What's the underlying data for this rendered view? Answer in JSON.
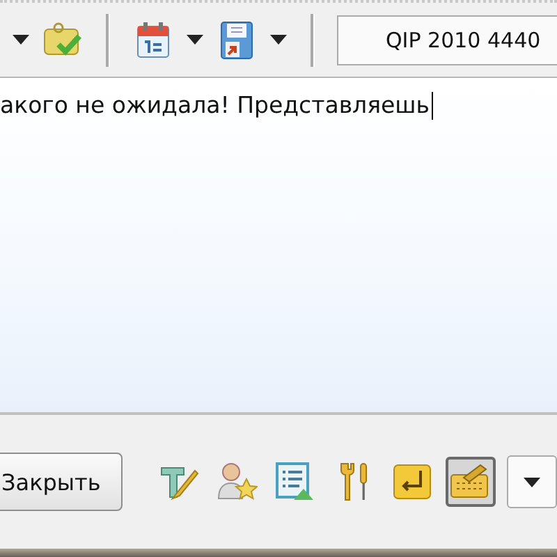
{
  "top_toolbar": {
    "items": [
      {
        "kind": "dropdown"
      },
      {
        "kind": "note"
      },
      {
        "kind": "separator"
      },
      {
        "kind": "calendar"
      },
      {
        "kind": "dropdown"
      },
      {
        "kind": "floppy"
      },
      {
        "kind": "dropdown"
      },
      {
        "kind": "separator"
      }
    ],
    "status_field": {
      "value": "QIP 2010 4440"
    }
  },
  "message": {
    "value": "акого не ожидала! Представляешь"
  },
  "bottom_bar": {
    "close_button": "Закрыть",
    "tools": [
      {
        "kind": "text-style",
        "selected": false
      },
      {
        "kind": "contact-star",
        "selected": false
      },
      {
        "kind": "list",
        "selected": false
      },
      {
        "kind": "tools",
        "selected": false
      },
      {
        "kind": "enter",
        "selected": false
      },
      {
        "kind": "keyboard",
        "selected": true
      }
    ],
    "menu_button": {
      "kind": "dropdown"
    }
  }
}
